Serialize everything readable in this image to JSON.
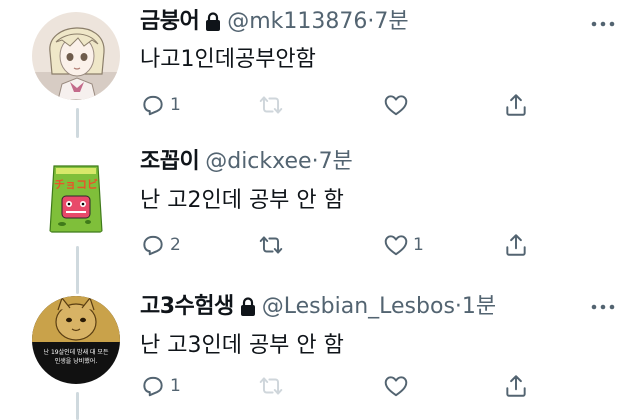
{
  "tweets": [
    {
      "display_name": "금붕어",
      "locked": true,
      "handle": "@mk113876",
      "separator": "·",
      "time": "7분",
      "text": "나고1인데공부안함",
      "reply_count": "1",
      "retweet_count": "",
      "like_count": ""
    },
    {
      "display_name": "조꼽이",
      "locked": false,
      "handle": "@dickxee",
      "separator": "·",
      "time": "7분",
      "text": "난 고2인데 공부 안 함",
      "reply_count": "2",
      "retweet_count": "",
      "like_count": "1"
    },
    {
      "display_name": "고3수험생",
      "locked": true,
      "handle": "@Lesbian_Lesbos",
      "separator": "·",
      "time": "1분",
      "text": "난 고3인데 공부 안 함",
      "reply_count": "1",
      "retweet_count": "",
      "like_count": ""
    }
  ],
  "avatar_texts": {
    "tweet2_snack": "チョコビ",
    "tweet3_caption_line1": "난 19살인데 밤새 대 모든",
    "tweet3_caption_line2": "인생을 낭비했어."
  },
  "icons": {
    "lock": "lock-icon",
    "more": "more-horizontal-icon",
    "reply": "reply-icon",
    "retweet": "retweet-icon",
    "like": "heart-icon",
    "share": "share-icon"
  },
  "colors": {
    "text_primary": "#0f1419",
    "text_secondary": "#536471",
    "thread_line": "#cfd9de",
    "background": "#ffffff"
  }
}
